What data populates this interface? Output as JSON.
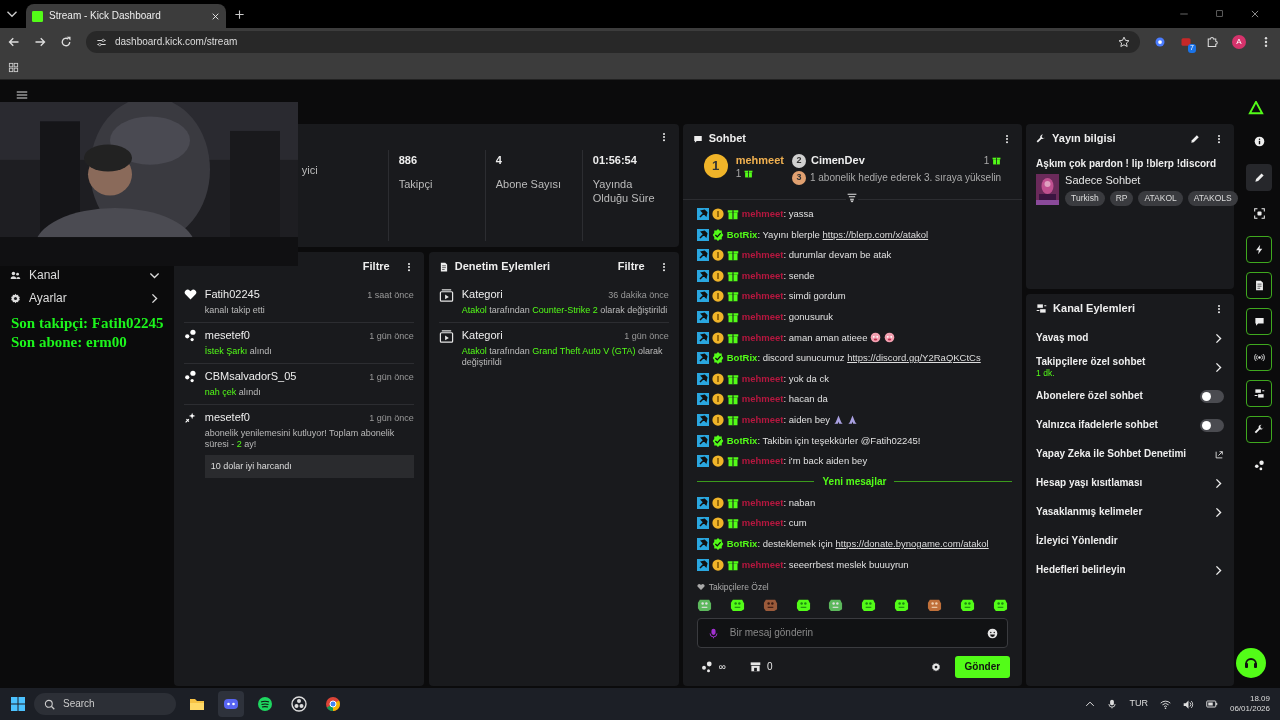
{
  "browser": {
    "tabs": [
      {
        "title": "Stream - Kick Dashboard",
        "selected": true
      }
    ],
    "url": "dashboard.kick.com/stream",
    "extension_badge": "7",
    "profile": "A"
  },
  "sidebar": {
    "items": [
      {
        "label": "Kanal",
        "kind": "channel",
        "expanded": true
      },
      {
        "label": "Ayarlar",
        "kind": "settings",
        "expanded": false
      }
    ]
  },
  "overlay": [
    "Son takipçi: Fatih02245",
    "Son abone: erm00"
  ],
  "stats": [
    {
      "label": "yici"
    },
    {
      "value": "886",
      "label": "Takipçi"
    },
    {
      "value": "4",
      "label": "Abone Sayısı"
    },
    {
      "value": "01:56:54",
      "label": "Yayında Olduğu Süre"
    }
  ],
  "activity": {
    "filter": "Filtre",
    "items": [
      {
        "kind": "follow",
        "user": "Fatih02245",
        "time": "1 saat önce",
        "parts": [
          {
            "text": "kanalı takip etti",
            "accent": false
          }
        ]
      },
      {
        "kind": "redeem",
        "user": "mesetef0",
        "time": "1 gün önce",
        "parts": [
          {
            "text": "İstek Şarkı",
            "accent": true
          },
          {
            "text": " alındı",
            "accent": false
          }
        ]
      },
      {
        "kind": "redeem",
        "user": "CBMsalvadorS_05",
        "time": "1 gün önce",
        "parts": [
          {
            "text": "nah çek",
            "accent": true
          },
          {
            "text": " alındı",
            "accent": false
          }
        ]
      },
      {
        "kind": "sub",
        "user": "mesetef0",
        "time": "1 gün önce",
        "parts": [
          {
            "text": "abonelik yenilemesini kutluyor! Toplam abonelik süresi - ",
            "accent": false
          },
          {
            "text": "2",
            "accent": true
          },
          {
            "text": " ay!",
            "accent": false
          }
        ],
        "message": "10 dolar iyi harcandı"
      }
    ]
  },
  "moderation": {
    "title": "Denetim Eylemleri",
    "filter": "Filtre",
    "items": [
      {
        "title": "Kategori",
        "time": "36 dakika önce",
        "parts": [
          {
            "text": "Atakol",
            "accent": true
          },
          {
            "text": " tarafından ",
            "accent": false
          },
          {
            "text": "Counter-Strike 2",
            "accent": true
          },
          {
            "text": " olarak değiştirildi",
            "accent": false
          }
        ]
      },
      {
        "title": "Kategori",
        "time": "1 gün önce",
        "parts": [
          {
            "text": "Atakol",
            "accent": true
          },
          {
            "text": " tarafından ",
            "accent": false
          },
          {
            "text": "Grand Theft Auto V (GTA)",
            "accent": true
          },
          {
            "text": " olarak değiştirildi",
            "accent": false
          }
        ]
      }
    ]
  },
  "chat": {
    "title": "Sohbet",
    "leaders": [
      {
        "rank": "1",
        "user": "mehmeet",
        "count": "1"
      },
      {
        "rank": "2",
        "user": "CimenDev",
        "count": "1"
      }
    ],
    "prompt": {
      "rank": "3",
      "text": "1 abonelik hediye ederek 3. sıraya yükselin"
    },
    "messages": [
      {
        "kind": "message",
        "badges": [
          {
            "kind": "mod"
          },
          {
            "kind": "sub"
          },
          {
            "kind": "gift"
          }
        ],
        "user": "mehmeet",
        "color": "#b5173f",
        "text": ": yassa"
      },
      {
        "kind": "message",
        "badges": [
          {
            "kind": "mod"
          },
          {
            "kind": "verified"
          }
        ],
        "user": "BotRix",
        "color": "#53fc18",
        "text": ": Yayını blerple ",
        "link": "https://blerp.com/x/atakol"
      },
      {
        "kind": "message",
        "badges": [
          {
            "kind": "mod"
          },
          {
            "kind": "sub"
          },
          {
            "kind": "gift"
          }
        ],
        "user": "mehmeet",
        "color": "#b5173f",
        "text": ": durumlar devam be atak"
      },
      {
        "kind": "message",
        "badges": [
          {
            "kind": "mod"
          },
          {
            "kind": "sub"
          },
          {
            "kind": "gift"
          }
        ],
        "user": "mehmeet",
        "color": "#b5173f",
        "text": ": sende"
      },
      {
        "kind": "message",
        "badges": [
          {
            "kind": "mod"
          },
          {
            "kind": "sub"
          },
          {
            "kind": "gift"
          }
        ],
        "user": "mehmeet",
        "color": "#b5173f",
        "text": ": simdi gordum"
      },
      {
        "kind": "message",
        "badges": [
          {
            "kind": "mod"
          },
          {
            "kind": "sub"
          },
          {
            "kind": "gift"
          }
        ],
        "user": "mehmeet",
        "color": "#b5173f",
        "text": ": gonusuruk"
      },
      {
        "kind": "message",
        "badges": [
          {
            "kind": "mod"
          },
          {
            "kind": "sub"
          },
          {
            "kind": "gift"
          }
        ],
        "user": "mehmeet",
        "color": "#b5173f",
        "text": ": aman aman atieee ",
        "emotes": [
          {
            "kind": "face"
          },
          {
            "kind": "face"
          }
        ]
      },
      {
        "kind": "message",
        "badges": [
          {
            "kind": "mod"
          },
          {
            "kind": "verified"
          }
        ],
        "user": "BotRix",
        "color": "#53fc18",
        "text": ": discord sunucumuz ",
        "link": "https://discord.gg/Y2RaQKCtCs"
      },
      {
        "kind": "message",
        "badges": [
          {
            "kind": "mod"
          },
          {
            "kind": "sub"
          },
          {
            "kind": "gift"
          }
        ],
        "user": "mehmeet",
        "color": "#b5173f",
        "text": ": yok da ck"
      },
      {
        "kind": "message",
        "badges": [
          {
            "kind": "mod"
          },
          {
            "kind": "sub"
          },
          {
            "kind": "gift"
          }
        ],
        "user": "mehmeet",
        "color": "#b5173f",
        "text": ": hacan da"
      },
      {
        "kind": "message",
        "badges": [
          {
            "kind": "mod"
          },
          {
            "kind": "sub"
          },
          {
            "kind": "gift"
          }
        ],
        "user": "mehmeet",
        "color": "#b5173f",
        "text": ": aiden bey ",
        "emotes": [
          {
            "kind": "hands"
          },
          {
            "kind": "hands"
          }
        ]
      },
      {
        "kind": "message",
        "badges": [
          {
            "kind": "mod"
          },
          {
            "kind": "verified"
          }
        ],
        "user": "BotRix",
        "color": "#53fc18",
        "text": ": Takibin için teşekkürler @Fatih02245!"
      },
      {
        "kind": "message",
        "badges": [
          {
            "kind": "mod"
          },
          {
            "kind": "sub"
          },
          {
            "kind": "gift"
          }
        ],
        "user": "mehmeet",
        "color": "#b5173f",
        "text": ": i'm back aiden bey"
      },
      {
        "kind": "divider",
        "text": "Yeni mesajlar"
      },
      {
        "kind": "message",
        "badges": [
          {
            "kind": "mod"
          },
          {
            "kind": "sub"
          },
          {
            "kind": "gift"
          }
        ],
        "user": "mehmeet",
        "color": "#b5173f",
        "text": ": naban"
      },
      {
        "kind": "message",
        "badges": [
          {
            "kind": "mod"
          },
          {
            "kind": "sub"
          },
          {
            "kind": "gift"
          }
        ],
        "user": "mehmeet",
        "color": "#b5173f",
        "text": ": cum"
      },
      {
        "kind": "message",
        "badges": [
          {
            "kind": "mod"
          },
          {
            "kind": "verified"
          }
        ],
        "user": "BotRix",
        "color": "#53fc18",
        "text": ": desteklemek için ",
        "link": "https://donate.bynogame.com/atakol"
      },
      {
        "kind": "message",
        "badges": [
          {
            "kind": "mod"
          },
          {
            "kind": "sub"
          },
          {
            "kind": "gift"
          }
        ],
        "user": "mehmeet",
        "color": "#b5173f",
        "text": ": seeerrbest meslek buuuyrun"
      }
    ],
    "emote_label": "Takipçilere Özel",
    "emotes": [
      {
        "kind": "frog"
      },
      {
        "kind": "blob"
      },
      {
        "kind": "brown"
      },
      {
        "kind": "blob"
      },
      {
        "kind": "frog"
      },
      {
        "kind": "blob"
      },
      {
        "kind": "blob"
      },
      {
        "kind": "monkey"
      },
      {
        "kind": "blob"
      },
      {
        "kind": "blob"
      }
    ],
    "input": {
      "placeholder": "Bir mesaj gönderin"
    },
    "points": "∞",
    "store": "0",
    "send": "Gönder"
  },
  "stream_info": {
    "header": "Yayın bilgisi",
    "title": "Aşkım çok pardon ! lip !blerp !discord",
    "category": "Sadece Sohbet",
    "tags": [
      "Turkish",
      "RP",
      "ATAKOL",
      "ATAKOLS"
    ]
  },
  "channel_actions": {
    "header": "Kanal Eylemleri",
    "items": [
      {
        "kind": "chevron",
        "label": "Yavaş mod"
      },
      {
        "kind": "chevron",
        "label": "Takipçilere özel sohbet",
        "sub": "1 dk."
      },
      {
        "kind": "toggle",
        "label": "Abonelere özel sohbet",
        "on": false
      },
      {
        "kind": "toggle",
        "label": "Yalnızca ifadelerle sohbet",
        "on": false
      },
      {
        "kind": "external",
        "label": "Yapay Zeka ile Sohbet Denetimi"
      },
      {
        "kind": "chevron",
        "label": "Hesap yaşı kısıtlaması"
      },
      {
        "kind": "chevron",
        "label": "Yasaklanmış kelimeler"
      },
      {
        "kind": "plain",
        "label": "İzleyici Yönlendir"
      },
      {
        "kind": "chevron",
        "label": "Hedefleri belirleyin"
      }
    ]
  },
  "rail": [
    {
      "kind": "info",
      "selected": false,
      "pinned": false
    },
    {
      "kind": "pencil",
      "selected": true,
      "pinned": false
    },
    {
      "kind": "focus",
      "selected": false,
      "pinned": false
    },
    {
      "kind": "bolt",
      "selected": false,
      "pinned": true
    },
    {
      "kind": "doc",
      "selected": false,
      "pinned": true
    },
    {
      "kind": "chat",
      "selected": false,
      "pinned": true
    },
    {
      "kind": "broadcast",
      "selected": false,
      "pinned": true
    },
    {
      "kind": "actions",
      "selected": false,
      "pinned": true
    },
    {
      "kind": "wrench",
      "selected": false,
      "pinned": true
    },
    {
      "kind": "dots",
      "selected": false,
      "pinned": false
    }
  ],
  "taskbar": {
    "search": "Search",
    "apps": [
      {
        "kind": "folder",
        "selected": false
      },
      {
        "kind": "discord",
        "selected": true
      },
      {
        "kind": "spotify",
        "selected": false
      },
      {
        "kind": "obs",
        "selected": false
      },
      {
        "kind": "chrome",
        "selected": false
      }
    ],
    "language": "TUR",
    "time": "18.09",
    "date": "06/01/2026"
  }
}
